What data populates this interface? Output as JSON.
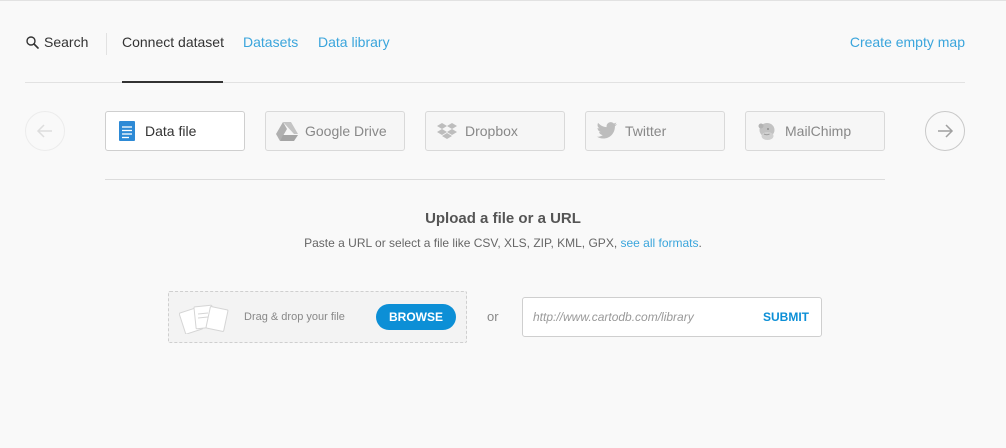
{
  "nav": {
    "search_label": "Search",
    "connect_label": "Connect dataset",
    "datasets_label": "Datasets",
    "library_label": "Data library",
    "create_label": "Create empty map"
  },
  "sources": [
    {
      "label": "Data file",
      "icon": "document-icon",
      "active": true
    },
    {
      "label": "Google Drive",
      "icon": "google-drive-icon",
      "active": false
    },
    {
      "label": "Dropbox",
      "icon": "dropbox-icon",
      "active": false
    },
    {
      "label": "Twitter",
      "icon": "twitter-icon",
      "active": false
    },
    {
      "label": "MailChimp",
      "icon": "mailchimp-icon",
      "active": false
    }
  ],
  "upload": {
    "title": "Upload a file or a URL",
    "desc_prefix": "Paste a URL or select a file like CSV, XLS, ZIP, KML, GPX, ",
    "formats_link": "see all formats",
    "desc_suffix": ".",
    "drop_label": "Drag & drop your file",
    "browse_label": "BROWSE",
    "or_label": "or",
    "url_placeholder": "http://www.cartodb.com/library",
    "submit_label": "SUBMIT"
  },
  "colors": {
    "accent": "#3aa5dc",
    "button_blue": "#0c8fd6",
    "background": "#f9f9f9"
  }
}
